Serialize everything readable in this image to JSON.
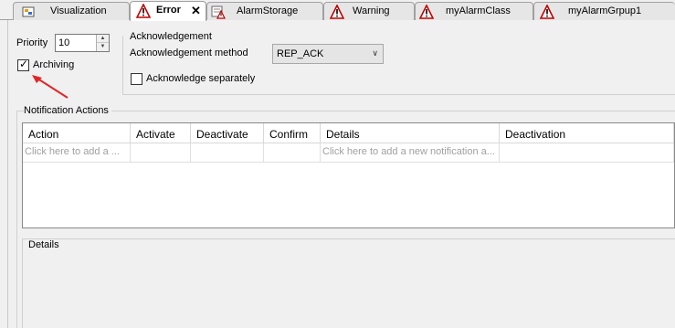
{
  "tabs": [
    {
      "label": "Visualization",
      "icon": "visualization-icon",
      "active": false
    },
    {
      "label": "Error",
      "icon": "warning-triangle-icon",
      "active": true
    },
    {
      "label": "AlarmStorage",
      "icon": "alarm-storage-icon",
      "active": false
    },
    {
      "label": "Warning",
      "icon": "warning-triangle-icon",
      "active": false
    },
    {
      "label": "myAlarmClass",
      "icon": "warning-triangle-icon",
      "active": false
    },
    {
      "label": "myAlarmGrpup1",
      "icon": "warning-triangle-icon",
      "active": false
    }
  ],
  "priority": {
    "label": "Priority",
    "value": "10"
  },
  "archiving": {
    "label": "Archiving",
    "checked": true
  },
  "acknowledgement": {
    "group_title": "Acknowledgement",
    "method_label": "Acknowledgement method",
    "method_value": "REP_ACK",
    "separately_label": "Acknowledge separately",
    "separately_checked": false
  },
  "notification": {
    "title": "Notification Actions",
    "columns": [
      "Action",
      "Activate",
      "Deactivate",
      "Confirm",
      "Details",
      "Deactivation"
    ],
    "row": [
      "Click here to add a ...",
      "",
      "",
      "",
      "Click here to add a new notification a...",
      ""
    ]
  },
  "details": {
    "title": "Details"
  },
  "colors": {
    "accent_red": "#cc0000",
    "annotation_arrow": "#e0262a"
  }
}
